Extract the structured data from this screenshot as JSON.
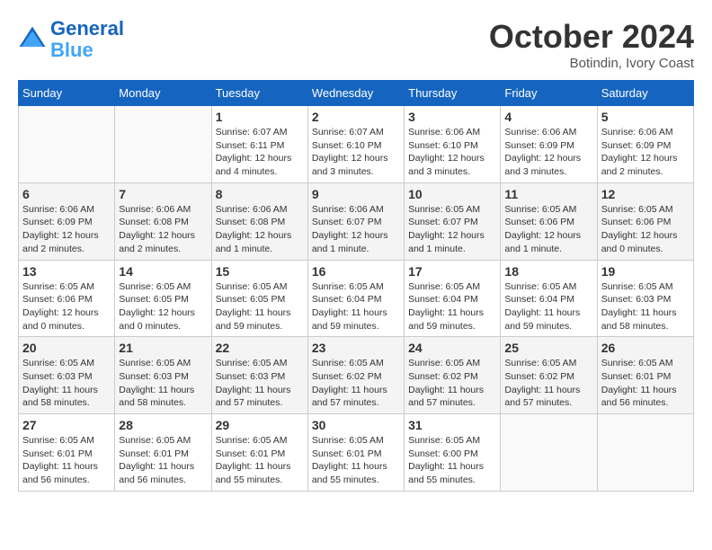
{
  "header": {
    "logo_line1": "General",
    "logo_line2": "Blue",
    "month": "October 2024",
    "location": "Botindin, Ivory Coast"
  },
  "days_of_week": [
    "Sunday",
    "Monday",
    "Tuesday",
    "Wednesday",
    "Thursday",
    "Friday",
    "Saturday"
  ],
  "weeks": [
    [
      {
        "day": "",
        "detail": ""
      },
      {
        "day": "",
        "detail": ""
      },
      {
        "day": "1",
        "detail": "Sunrise: 6:07 AM\nSunset: 6:11 PM\nDaylight: 12 hours and 4 minutes."
      },
      {
        "day": "2",
        "detail": "Sunrise: 6:07 AM\nSunset: 6:10 PM\nDaylight: 12 hours and 3 minutes."
      },
      {
        "day": "3",
        "detail": "Sunrise: 6:06 AM\nSunset: 6:10 PM\nDaylight: 12 hours and 3 minutes."
      },
      {
        "day": "4",
        "detail": "Sunrise: 6:06 AM\nSunset: 6:09 PM\nDaylight: 12 hours and 3 minutes."
      },
      {
        "day": "5",
        "detail": "Sunrise: 6:06 AM\nSunset: 6:09 PM\nDaylight: 12 hours and 2 minutes."
      }
    ],
    [
      {
        "day": "6",
        "detail": "Sunrise: 6:06 AM\nSunset: 6:09 PM\nDaylight: 12 hours and 2 minutes."
      },
      {
        "day": "7",
        "detail": "Sunrise: 6:06 AM\nSunset: 6:08 PM\nDaylight: 12 hours and 2 minutes."
      },
      {
        "day": "8",
        "detail": "Sunrise: 6:06 AM\nSunset: 6:08 PM\nDaylight: 12 hours and 1 minute."
      },
      {
        "day": "9",
        "detail": "Sunrise: 6:06 AM\nSunset: 6:07 PM\nDaylight: 12 hours and 1 minute."
      },
      {
        "day": "10",
        "detail": "Sunrise: 6:05 AM\nSunset: 6:07 PM\nDaylight: 12 hours and 1 minute."
      },
      {
        "day": "11",
        "detail": "Sunrise: 6:05 AM\nSunset: 6:06 PM\nDaylight: 12 hours and 1 minute."
      },
      {
        "day": "12",
        "detail": "Sunrise: 6:05 AM\nSunset: 6:06 PM\nDaylight: 12 hours and 0 minutes."
      }
    ],
    [
      {
        "day": "13",
        "detail": "Sunrise: 6:05 AM\nSunset: 6:06 PM\nDaylight: 12 hours and 0 minutes."
      },
      {
        "day": "14",
        "detail": "Sunrise: 6:05 AM\nSunset: 6:05 PM\nDaylight: 12 hours and 0 minutes."
      },
      {
        "day": "15",
        "detail": "Sunrise: 6:05 AM\nSunset: 6:05 PM\nDaylight: 11 hours and 59 minutes."
      },
      {
        "day": "16",
        "detail": "Sunrise: 6:05 AM\nSunset: 6:04 PM\nDaylight: 11 hours and 59 minutes."
      },
      {
        "day": "17",
        "detail": "Sunrise: 6:05 AM\nSunset: 6:04 PM\nDaylight: 11 hours and 59 minutes."
      },
      {
        "day": "18",
        "detail": "Sunrise: 6:05 AM\nSunset: 6:04 PM\nDaylight: 11 hours and 59 minutes."
      },
      {
        "day": "19",
        "detail": "Sunrise: 6:05 AM\nSunset: 6:03 PM\nDaylight: 11 hours and 58 minutes."
      }
    ],
    [
      {
        "day": "20",
        "detail": "Sunrise: 6:05 AM\nSunset: 6:03 PM\nDaylight: 11 hours and 58 minutes."
      },
      {
        "day": "21",
        "detail": "Sunrise: 6:05 AM\nSunset: 6:03 PM\nDaylight: 11 hours and 58 minutes."
      },
      {
        "day": "22",
        "detail": "Sunrise: 6:05 AM\nSunset: 6:03 PM\nDaylight: 11 hours and 57 minutes."
      },
      {
        "day": "23",
        "detail": "Sunrise: 6:05 AM\nSunset: 6:02 PM\nDaylight: 11 hours and 57 minutes."
      },
      {
        "day": "24",
        "detail": "Sunrise: 6:05 AM\nSunset: 6:02 PM\nDaylight: 11 hours and 57 minutes."
      },
      {
        "day": "25",
        "detail": "Sunrise: 6:05 AM\nSunset: 6:02 PM\nDaylight: 11 hours and 57 minutes."
      },
      {
        "day": "26",
        "detail": "Sunrise: 6:05 AM\nSunset: 6:01 PM\nDaylight: 11 hours and 56 minutes."
      }
    ],
    [
      {
        "day": "27",
        "detail": "Sunrise: 6:05 AM\nSunset: 6:01 PM\nDaylight: 11 hours and 56 minutes."
      },
      {
        "day": "28",
        "detail": "Sunrise: 6:05 AM\nSunset: 6:01 PM\nDaylight: 11 hours and 56 minutes."
      },
      {
        "day": "29",
        "detail": "Sunrise: 6:05 AM\nSunset: 6:01 PM\nDaylight: 11 hours and 55 minutes."
      },
      {
        "day": "30",
        "detail": "Sunrise: 6:05 AM\nSunset: 6:01 PM\nDaylight: 11 hours and 55 minutes."
      },
      {
        "day": "31",
        "detail": "Sunrise: 6:05 AM\nSunset: 6:00 PM\nDaylight: 11 hours and 55 minutes."
      },
      {
        "day": "",
        "detail": ""
      },
      {
        "day": "",
        "detail": ""
      }
    ]
  ]
}
